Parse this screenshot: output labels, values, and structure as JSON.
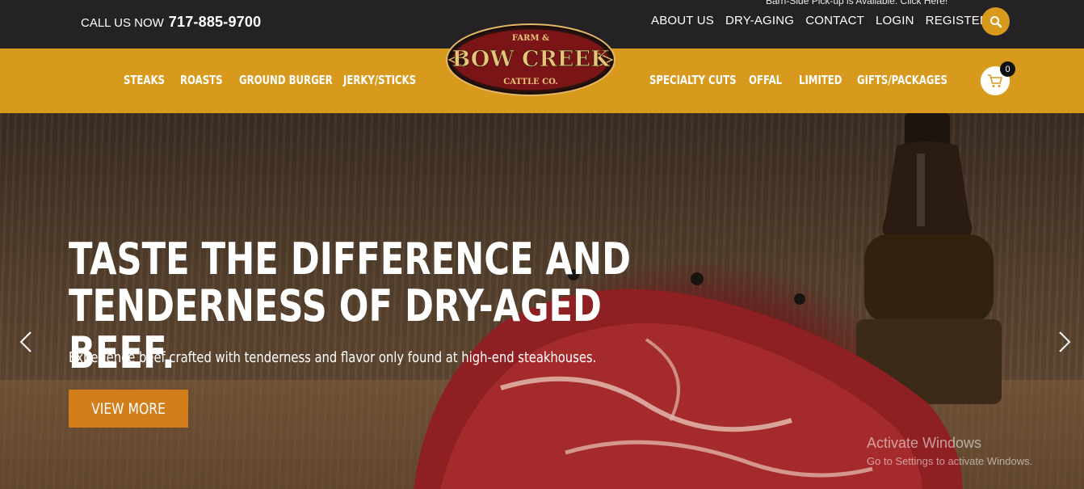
{
  "topbar": {
    "notice": "Barn-Side Pick-up is Available. Click Here!",
    "call_label": "CALL US NOW",
    "phone": "717-885-9700",
    "links": [
      "ABOUT US",
      "DRY-AGING",
      "CONTACT",
      "LOGIN",
      "REGISTER"
    ],
    "search_icon": "search-icon"
  },
  "logo": {
    "top": "FARM &",
    "name": "BOW CREEK",
    "bottom": "CATTLE CO."
  },
  "nav": {
    "left": [
      "STEAKS",
      "ROASTS",
      "GROUND BURGER",
      "JERKY/STICKS"
    ],
    "right": [
      "SPECIALTY CUTS",
      "OFFAL",
      "LIMITED",
      "GIFTS/PACKAGES"
    ],
    "cart_count": "0",
    "cart_icon": "cart-icon"
  },
  "hero": {
    "headline_line1": "TASTE THE DIFFERENCE AND",
    "headline_line2": "TENDERNESS OF DRY-AGED BEEF.",
    "subtitle": "Experience beef crafted with tenderness and flavor only found at high-end steakhouses.",
    "button_label": "VIEW MORE",
    "prev_icon": "chevron-left-icon",
    "next_icon": "chevron-right-icon"
  },
  "watermark": {
    "line1": "Activate Windows",
    "line2": "Go to Settings to activate Windows."
  },
  "colors": {
    "gold": "#d79a1c",
    "dark": "#242224",
    "cta": "#d27f1b"
  }
}
